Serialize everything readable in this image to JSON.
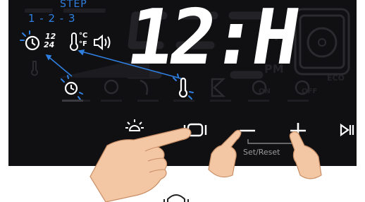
{
  "display": {
    "time_text": "12:H",
    "step_title": "STEP",
    "step_sequence": "1 - 2 - 3",
    "fmt_12": "12",
    "fmt_24": "24",
    "unit_c": "°C",
    "unit_f": "°F",
    "ghost_f": "°F",
    "ghost_pm": "PM",
    "ghost_eco": "ECO",
    "ghost_on": "ON",
    "ghost_off": "OFF"
  },
  "controls": {
    "set_reset_label": "Set/Reset"
  },
  "colors": {
    "accent": "#2f7fe0",
    "panel": "#101012",
    "segment_on": "#ffffff",
    "segment_off": "#242428"
  },
  "icons": [
    "clock-icon",
    "thermometer-icon",
    "sound-icon",
    "fan-icon",
    "hourglass-icon",
    "light-icon",
    "steam-icon",
    "minus-icon",
    "plus-icon",
    "play-pause-icon",
    "hand-icon"
  ]
}
